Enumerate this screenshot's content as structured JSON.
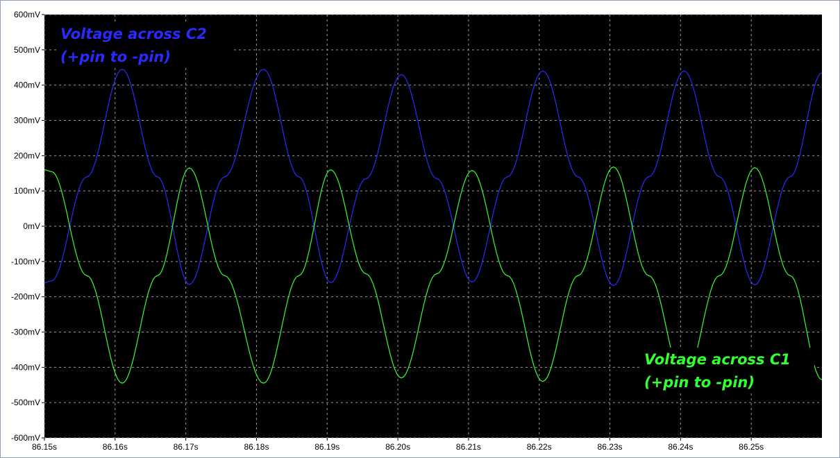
{
  "chart_data": {
    "type": "line",
    "title": "",
    "xlabel": "",
    "ylabel": "",
    "xlim": [
      86.15,
      86.26
    ],
    "ylim": [
      -600,
      600
    ],
    "grid": true,
    "x_ticks": [
      86.15,
      86.16,
      86.17,
      86.18,
      86.19,
      86.2,
      86.21,
      86.22,
      86.23,
      86.24,
      86.25
    ],
    "x_tick_labels": [
      "86.15s",
      "86.16s",
      "86.17s",
      "86.18s",
      "86.19s",
      "86.20s",
      "86.21s",
      "86.22s",
      "86.23s",
      "86.24s",
      "86.25s"
    ],
    "y_ticks": [
      600,
      500,
      400,
      300,
      200,
      100,
      0,
      -100,
      -200,
      -300,
      -400,
      -500,
      -600
    ],
    "y_tick_labels": [
      "600mV",
      "500mV",
      "400mV",
      "300mV",
      "200mV",
      "100mV",
      "0mV",
      "-100mV",
      "-200mV",
      "-300mV",
      "-400mV",
      "-500mV",
      "-600mV"
    ],
    "series": [
      {
        "color": "#2a2aff",
        "x": [
          86.15,
          86.151,
          86.156,
          86.161,
          86.166,
          86.1705,
          86.1755,
          86.181,
          86.186,
          86.1905,
          86.1955,
          86.2005,
          86.2055,
          86.2105,
          86.2155,
          86.2205,
          86.2255,
          86.2305,
          86.2355,
          86.2405,
          86.2455,
          86.2505,
          86.2555,
          86.26
        ],
        "y": [
          -160,
          -155,
          140,
          445,
          140,
          -165,
          140,
          445,
          140,
          -160,
          135,
          430,
          135,
          -158,
          140,
          440,
          140,
          -168,
          140,
          440,
          140,
          -166,
          140,
          435
        ]
      },
      {
        "color": "#33ff33",
        "x": [
          86.15,
          86.151,
          86.156,
          86.161,
          86.166,
          86.1705,
          86.1755,
          86.181,
          86.186,
          86.1905,
          86.1955,
          86.2005,
          86.2055,
          86.2105,
          86.2155,
          86.2205,
          86.2255,
          86.2305,
          86.2355,
          86.2405,
          86.2455,
          86.2505,
          86.2555,
          86.26
        ],
        "y": [
          160,
          155,
          -140,
          -445,
          -140,
          165,
          -140,
          -445,
          -140,
          160,
          -135,
          -430,
          -135,
          158,
          -140,
          -440,
          -140,
          168,
          -140,
          -440,
          -140,
          166,
          -140,
          -435
        ]
      }
    ],
    "annotations": [
      {
        "line1": "Voltage across C2",
        "line2": "(+pin to -pin)",
        "color": "#2a2aff"
      },
      {
        "line1": "Voltage across C1",
        "line2": "(+pin to -pin)",
        "color": "#33ff33"
      }
    ]
  }
}
